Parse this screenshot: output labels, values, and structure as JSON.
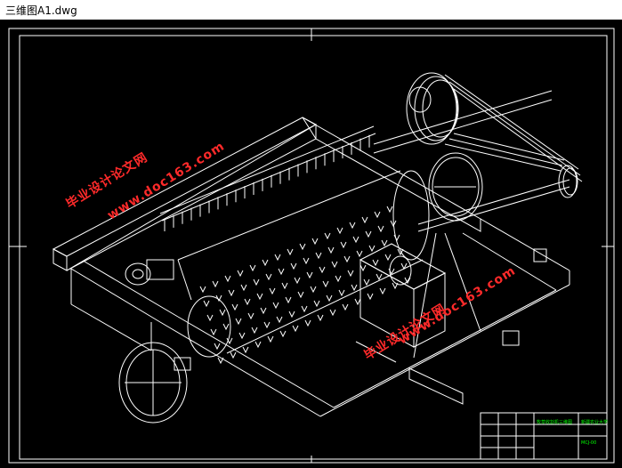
{
  "window": {
    "title": "三维图A1.dwg"
  },
  "colors": {
    "background": "#000000",
    "lines": "#ffffff",
    "titleblock_text": "#00ff00",
    "watermark": "#ff2a2a"
  },
  "watermarks": [
    {
      "line1": "毕业设计论文网",
      "line2": "www.doc163.com"
    },
    {
      "line1": "毕业设计论文网",
      "line2": "www.doc163.com"
    }
  ],
  "title_block": {
    "drawing_name": "牧草收割机三维图",
    "company": "新疆农业大学",
    "drawing_no": "MCJ-00"
  }
}
